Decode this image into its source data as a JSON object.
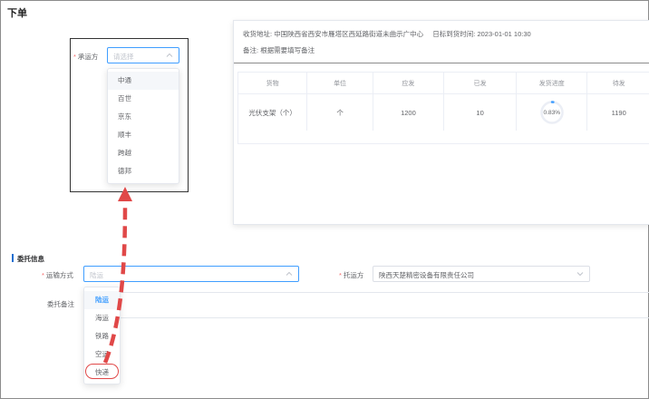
{
  "page": {
    "title": "下单"
  },
  "order_info": {
    "address_label": "收货地址:",
    "address_value": "中国陕西省西安市雁塔区西延路街道未曲示广中心",
    "deadline_label": "日标到货时间:",
    "deadline_value": "2023-01-01 10:30",
    "note_label": "备注:",
    "note_value": "根据需要填写备注"
  },
  "goods_table": {
    "headers": [
      "货物",
      "单位",
      "应发",
      "已发",
      "发货进度",
      "待发"
    ],
    "rows": [
      {
        "goods": "光伏支架（个）",
        "unit": "个",
        "due": "1200",
        "sent": "10",
        "progress_text": "0.83%",
        "progress": 0.0083,
        "pending": "1190"
      }
    ]
  },
  "carrier_select": {
    "label": "承运方",
    "placeholder": "请选择",
    "options": [
      "中通",
      "百世",
      "京东",
      "顺丰",
      "跨越",
      "德邦"
    ],
    "highlighted": "中通"
  },
  "section": {
    "title": "委托信息"
  },
  "transport_select": {
    "label": "运输方式",
    "value": "陆运",
    "options": [
      "陆运",
      "海运",
      "铁路",
      "空运",
      "快递"
    ],
    "selected": "陆运",
    "circled": "快递"
  },
  "consignor_select": {
    "label": "托运方",
    "value": "陕西天楚精密设备有限责任公司"
  },
  "remark": {
    "label": "委托备注"
  },
  "colors": {
    "primary": "#409eff",
    "required": "#f56c6c",
    "annotation": "#e04848",
    "section_bar": "#1f6fd0"
  },
  "icons": {
    "chevron": "chevron-up-icon",
    "chevron_down": "chevron-down-icon"
  }
}
